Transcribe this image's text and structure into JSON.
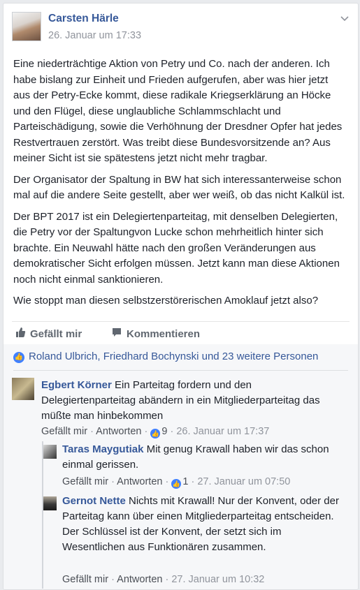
{
  "post": {
    "author": "Carsten Härle",
    "timestamp": "26. Januar um 17:33",
    "paragraphs": [
      "Eine niederträchtige Aktion von Petry und Co. nach der anderen. Ich habe bislang zur Einheit und Frieden aufgerufen, aber was hier jetzt aus der Petry-Ecke kommt, diese radikale Kriegserklärung an Höcke und den Flügel, diese unglaubliche Schlammschlacht und Parteischädigung, sowie die Verhöhnung der Dresdner Opfer hat jedes Restvertrauen zerstört. Was treibt diese Bundesvorsitzende an? Aus meiner Sicht ist sie spätestens jetzt nicht mehr tragbar.",
      "Der Organisator der Spaltung in BW hat sich interessanterweise schon mal auf die andere Seite gestellt, aber wer weiß, ob das nicht Kalkül ist.",
      "Der BPT 2017 ist ein Delegiertenparteitag, mit denselben Delegierten, die Petry vor der Spaltungvon Lucke schon mehrheitlich hinter sich brachte. Ein Neuwahl hätte nach den großen Veränderungen aus demokratischer Sicht erfolgen müssen. Jetzt kann man diese Aktionen noch nicht einmal sanktionieren.",
      "Wie stoppt man diesen selbstzerstörerischen Amoklauf jetzt also?"
    ]
  },
  "actions": {
    "like": "Gefällt mir",
    "comment": "Kommentieren"
  },
  "likes_summary": "Roland Ulbrich, Friedhard Bochynski und 23 weitere Personen",
  "comments": [
    {
      "name": "Egbert Körner",
      "text": "Ein Parteitag fordern und den Delegiertenparteitag abändern in ein Mitgliederparteitag das müßte man hinbekommen",
      "like": "Gefällt mir",
      "reply": "Antworten",
      "reactions": "9",
      "time": "26. Januar um 17:37"
    },
    {
      "name": "Taras Maygutiak",
      "text": "Mit genug Krawall haben wir das schon einmal gerissen.",
      "like": "Gefällt mir",
      "reply": "Antworten",
      "reactions": "1",
      "time": "27. Januar um 07:50"
    },
    {
      "name": "Gernot Nette",
      "text": "Nichts mit Krawall! Nur der Konvent, oder der Parteitag kann über einen Mitgliederparteitag entscheiden. Der Schlüssel ist der Konvent, der setzt sich im Wesentlichen aus Funktionären zusammen.",
      "like": "Gefällt mir",
      "reply": "Antworten",
      "time": "27. Januar um 10:32"
    }
  ],
  "meta_separator": " · ",
  "colors": {
    "link": "#365899",
    "meta": "#90949c",
    "accent": "#4080ff",
    "background": "#f6f7f9"
  },
  "icons": [
    "chevron-down-icon",
    "thumbs-up-icon",
    "comment-icon",
    "like-reaction-icon"
  ]
}
